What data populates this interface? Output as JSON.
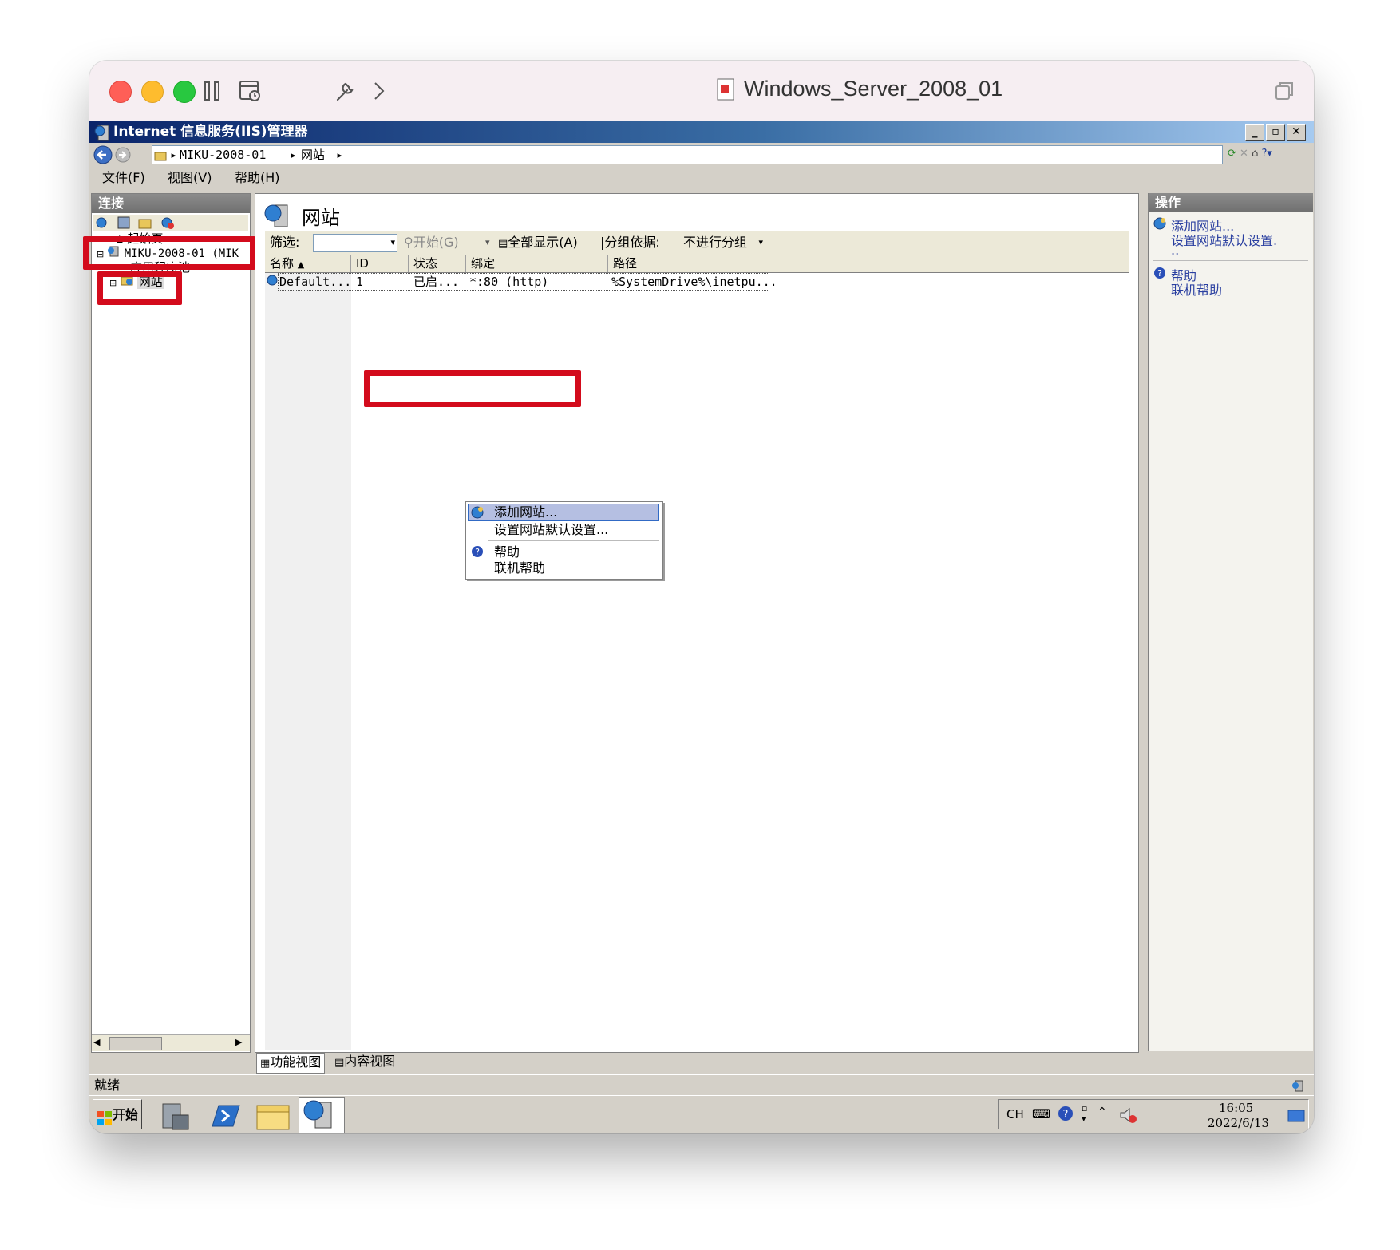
{
  "mac": {
    "window_title": "Windows_Server_2008_01"
  },
  "iis": {
    "title": "Internet 信息服务(IIS)管理器",
    "address": {
      "server": "MIKU-2008-01",
      "node": "网站"
    },
    "menu": [
      "文件(F)",
      "视图(V)",
      "帮助(H)"
    ],
    "connections": {
      "header": "连接",
      "tree": {
        "start_page": "起始页",
        "server": "MIKU-2008-01 (MIK",
        "app_pools": "应用程序池",
        "sites": "网站"
      }
    },
    "center": {
      "heading": "网站",
      "filter_label": "筛选:",
      "start_btn": "开始(G)",
      "show_all": "全部显示(A)",
      "group_label": "分组依据:",
      "group_value": "不进行分组",
      "columns": [
        "名称",
        "ID",
        "状态",
        "绑定",
        "路径"
      ],
      "rows": [
        {
          "name": "Default...",
          "id": "1",
          "status": "已启...",
          "binding": "*:80 (http)",
          "path": "%SystemDrive%\\inetpu..."
        }
      ]
    },
    "context_menu": {
      "add_site": "添加网站...",
      "set_defaults": "设置网站默认设置...",
      "help": "帮助",
      "online_help": "联机帮助"
    },
    "actions": {
      "header": "操作",
      "add_site": "添加网站...",
      "set_defaults": "设置网站默认设置.",
      "set_defaults_tail": "..",
      "help": "帮助",
      "online_help": "联机帮助"
    },
    "tabs": {
      "features": "功能视图",
      "content": "内容视图"
    },
    "status": "就绪"
  },
  "taskbar": {
    "start": "开始",
    "lang": "CH",
    "time": "16:05",
    "date": "2022/6/13"
  },
  "colors": {
    "highlight_red": "#d30b1c",
    "link_blue": "#2a3fa0",
    "title_gradient_start": "#0a246a"
  }
}
